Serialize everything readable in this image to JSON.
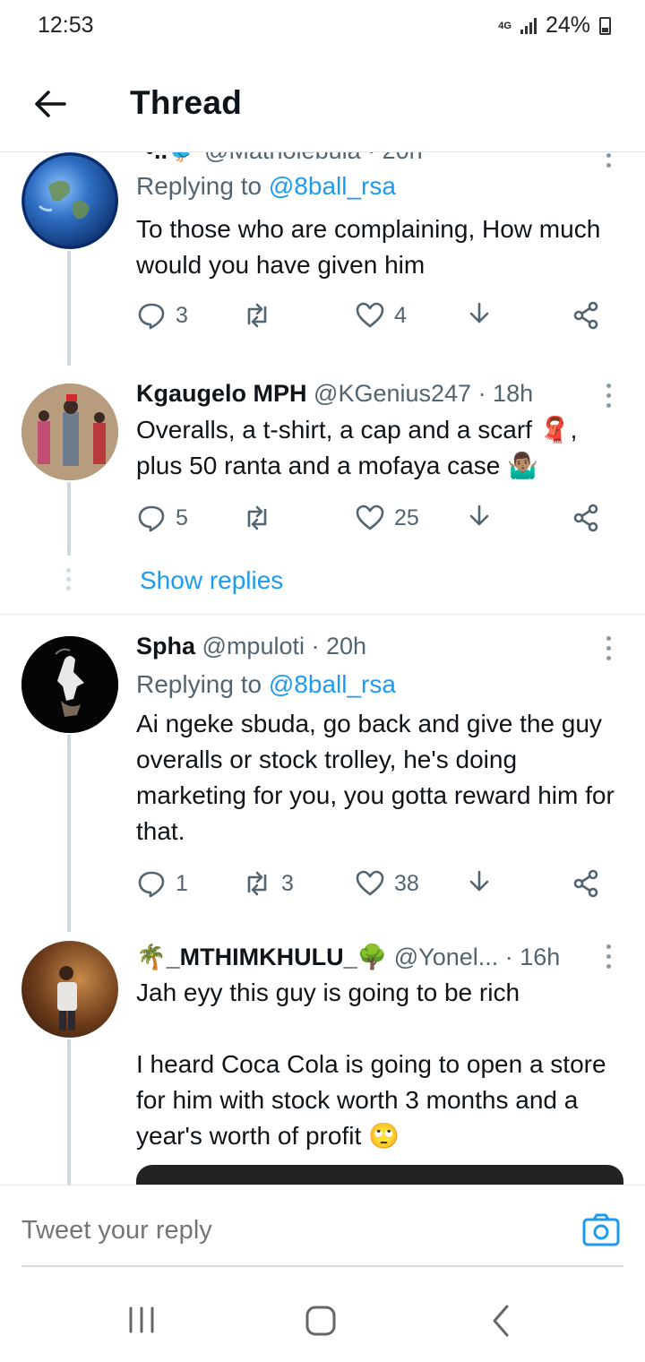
{
  "status": {
    "time": "12:53",
    "network": "4G",
    "battery": "24%"
  },
  "header": {
    "title": "Thread"
  },
  "tweets": [
    {
      "name": "*•..🐦",
      "handle": "@Matholebula",
      "time": "· 20h",
      "replying_prefix": "Replying to",
      "replying_handle": "@8ball_rsa",
      "text": "To those who are complaining, How much would you have given him",
      "replies": "3",
      "retweets": "",
      "likes": "4"
    },
    {
      "name": "Kgaugelo MPH",
      "handle": "@KGenius247",
      "time": "· 18h",
      "text": "Overalls, a t-shirt, a cap and a scarf 🧣,\nplus 50 ranta and a mofaya case 🤷🏽‍♂️",
      "replies": "5",
      "retweets": "",
      "likes": "25"
    },
    {
      "name": "Spha",
      "handle": "@mpuloti",
      "time": "· 20h",
      "replying_prefix": "Replying to",
      "replying_handle": "@8ball_rsa",
      "text": "Ai ngeke sbuda, go back and give the guy overalls or stock trolley, he's doing marketing for you, you gotta reward him for that.",
      "replies": "1",
      "retweets": "3",
      "likes": "38"
    },
    {
      "name": "🌴_MTHIMKHULU_🌳",
      "handle": "@Yonel...",
      "time": "· 16h",
      "text": "Jah eyy this guy is going to be rich\n\nI heard Coca Cola is going to open a store for him with stock worth 3 months and a year's worth of profit 🙄"
    }
  ],
  "show_replies": "Show replies",
  "reply_bar": {
    "placeholder": "Tweet your reply"
  },
  "icons": {
    "back": "arrow-left-icon",
    "more": "more-vertical-icon",
    "reply": "comment-icon",
    "retweet": "retweet-icon",
    "like": "heart-icon",
    "share": "share-icon",
    "bookmark": "download-icon",
    "camera": "camera-icon"
  },
  "colors": {
    "accent": "#1d9bf0",
    "muted": "#536471",
    "text": "#0f1419"
  }
}
